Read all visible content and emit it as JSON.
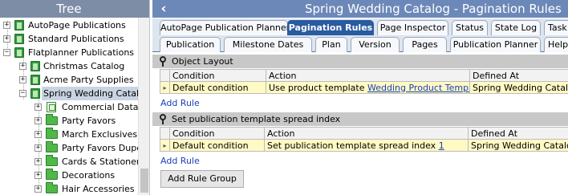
{
  "tree": {
    "title": "Tree",
    "items": [
      {
        "label": "AutoPage Publications",
        "expander": "+",
        "icon": "book-icon"
      },
      {
        "label": "Standard Publications",
        "expander": "+",
        "icon": "book-icon"
      },
      {
        "label": "Flatplanner Publications",
        "expander": "−",
        "icon": "book-icon"
      },
      {
        "label": "Christmas Catalog",
        "expander": "+",
        "icon": "book-icon"
      },
      {
        "label": "Acme Party Supplies",
        "expander": "+",
        "icon": "book-icon"
      },
      {
        "label": "Spring Wedding Catalog",
        "expander": "−",
        "icon": "book-icon",
        "selected": true
      },
      {
        "label": "Commercial Data",
        "expander": "+",
        "icon": "data-icon"
      },
      {
        "label": "Party Favors",
        "expander": "+",
        "icon": "folder-icon"
      },
      {
        "label": "March Exclusives",
        "expander": "+",
        "icon": "folder-icon"
      },
      {
        "label": "Party Favors Dupe",
        "expander": "+",
        "icon": "folder-icon"
      },
      {
        "label": "Cards & Stationery",
        "expander": "+",
        "icon": "folder-icon"
      },
      {
        "label": "Decorations",
        "expander": "+",
        "icon": "folder-icon"
      },
      {
        "label": "Hair Accessories",
        "expander": "+",
        "icon": "folder-icon"
      }
    ]
  },
  "header": {
    "back_icon": "chevron-left-icon",
    "title": "Spring Wedding Catalog - Pagination Rules"
  },
  "tabs_row1": [
    {
      "label": "AutoPage Publication Planner",
      "active": false
    },
    {
      "label": "Pagination Rules",
      "active": true
    },
    {
      "label": "Page Inspector",
      "active": false
    },
    {
      "label": "Status",
      "active": false
    },
    {
      "label": "State Log",
      "active": false
    },
    {
      "label": "Task",
      "active": false
    }
  ],
  "tabs_row2": [
    {
      "label": "Publication"
    },
    {
      "label": "Milestone Dates"
    },
    {
      "label": "Plan"
    },
    {
      "label": "Version"
    },
    {
      "label": "Pages"
    },
    {
      "label": "Publication Planner"
    },
    {
      "label": "Help"
    }
  ],
  "groups": [
    {
      "title": "Object Layout",
      "columns": [
        "Condition",
        "Action",
        "Defined At"
      ],
      "rows": [
        {
          "condition": "Default condition",
          "action_text": "Use product template ",
          "action_link": "Wedding Product Template",
          "defined_at": "Spring Wedding Catalog"
        }
      ],
      "add_rule": "Add Rule"
    },
    {
      "title": "Set publication template spread index",
      "columns": [
        "Condition",
        "Action",
        "Defined At"
      ],
      "rows": [
        {
          "condition": "Default condition",
          "action_text": "Set publication template spread index ",
          "action_link": "1",
          "defined_at": "Spring Wedding Catalog"
        }
      ],
      "add_rule": "Add Rule"
    }
  ],
  "add_rule_group": "Add Rule Group",
  "colors": {
    "tree_header": "#7d8da5",
    "title_bar": "#6c88b8",
    "active_tab": "#2a5aa0",
    "row_highlight": "#fff9c4",
    "group_header": "#c8c8c8"
  }
}
